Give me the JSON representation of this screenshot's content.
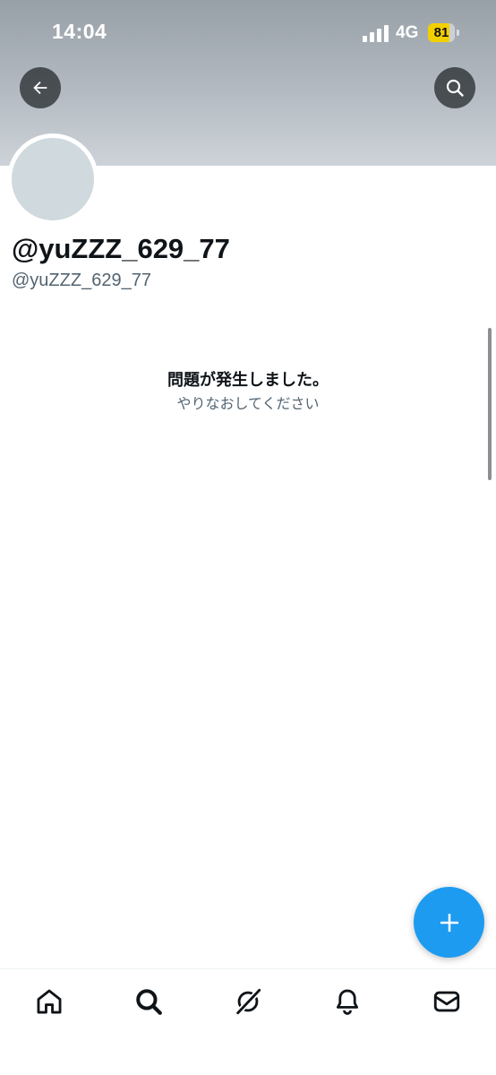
{
  "status_bar": {
    "time": "14:04",
    "network": "4G",
    "battery_level": "81",
    "battery_fraction": 0.81,
    "battery_color": "#f2d000"
  },
  "header": {
    "back_icon": "arrow-left-icon",
    "search_icon": "search-icon"
  },
  "profile": {
    "display_name": "@yuZZZ_629_77",
    "handle": "@yuZZZ_629_77",
    "avatar_color": "#cfd9de"
  },
  "error": {
    "title": "問題が発生しました。",
    "subtitle": "やりなおしてください"
  },
  "fab": {
    "icon": "plus-icon",
    "color": "#1d9bf0"
  },
  "tab_bar": {
    "items": [
      {
        "icon": "home-icon"
      },
      {
        "icon": "search-icon"
      },
      {
        "icon": "grok-icon"
      },
      {
        "icon": "bell-icon"
      },
      {
        "icon": "mail-icon"
      }
    ]
  }
}
